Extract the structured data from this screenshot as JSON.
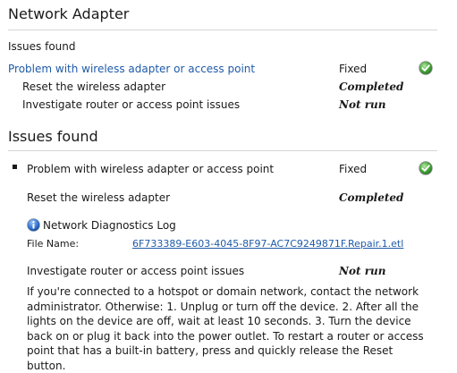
{
  "summary": {
    "title": "Network Adapter",
    "issues_heading": "Issues found",
    "problem": {
      "label": "Problem with wireless adapter or access point",
      "status": "Fixed",
      "icon": "check-icon"
    },
    "steps": [
      {
        "label": "Reset the wireless adapter",
        "status": "Completed"
      },
      {
        "label": "Investigate router or access point issues",
        "status": "Not run"
      }
    ]
  },
  "detail": {
    "title": "Issues found",
    "problem": {
      "label": "Problem with wireless adapter or access point",
      "status": "Fixed",
      "icon": "check-icon"
    },
    "reset_step": {
      "label": "Reset the wireless adapter",
      "status": "Completed"
    },
    "log": {
      "icon": "info-icon",
      "title": "Network Diagnostics Log",
      "file_label": "File Name:",
      "file_name": "6F733389-E603-4045-8F97-AC7C9249871F.Repair.1.etl"
    },
    "investigate_step": {
      "label": "Investigate router or access point issues",
      "status": "Not run"
    },
    "instructions": "If you're connected to a hotspot or domain network, contact the network administrator. Otherwise: 1. Unplug or turn off the device. 2. After all the lights on the device are off, wait at least 10 seconds. 3. Turn the device back on or plug it back into the power outlet. To restart a router or access point that has a built-in battery, press and quickly release the Reset button."
  },
  "colors": {
    "link": "#1e5aa8",
    "check_green": "#3aa63a",
    "info_blue": "#2f6fcf"
  }
}
